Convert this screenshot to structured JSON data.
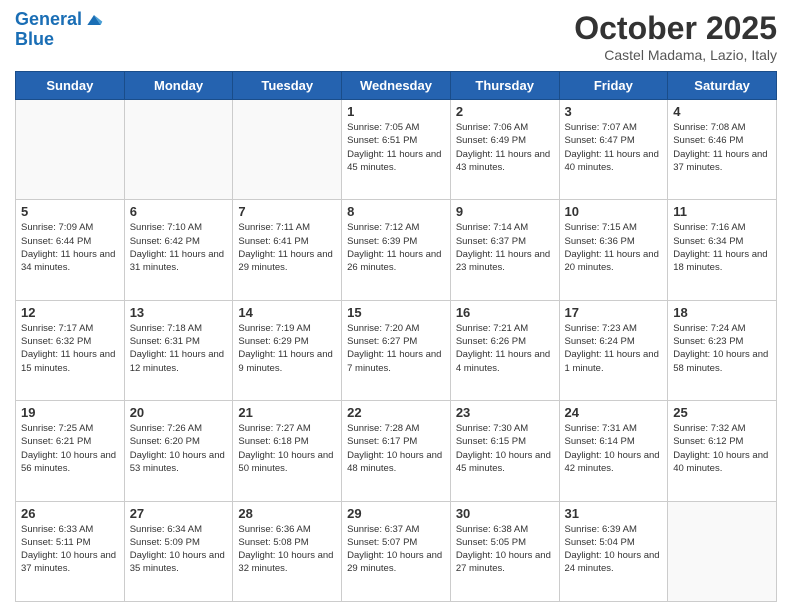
{
  "header": {
    "logo_line1": "General",
    "logo_line2": "Blue",
    "month": "October 2025",
    "location": "Castel Madama, Lazio, Italy"
  },
  "weekdays": [
    "Sunday",
    "Monday",
    "Tuesday",
    "Wednesday",
    "Thursday",
    "Friday",
    "Saturday"
  ],
  "rows": [
    [
      {
        "day": "",
        "info": ""
      },
      {
        "day": "",
        "info": ""
      },
      {
        "day": "",
        "info": ""
      },
      {
        "day": "1",
        "info": "Sunrise: 7:05 AM\nSunset: 6:51 PM\nDaylight: 11 hours and 45 minutes."
      },
      {
        "day": "2",
        "info": "Sunrise: 7:06 AM\nSunset: 6:49 PM\nDaylight: 11 hours and 43 minutes."
      },
      {
        "day": "3",
        "info": "Sunrise: 7:07 AM\nSunset: 6:47 PM\nDaylight: 11 hours and 40 minutes."
      },
      {
        "day": "4",
        "info": "Sunrise: 7:08 AM\nSunset: 6:46 PM\nDaylight: 11 hours and 37 minutes."
      }
    ],
    [
      {
        "day": "5",
        "info": "Sunrise: 7:09 AM\nSunset: 6:44 PM\nDaylight: 11 hours and 34 minutes."
      },
      {
        "day": "6",
        "info": "Sunrise: 7:10 AM\nSunset: 6:42 PM\nDaylight: 11 hours and 31 minutes."
      },
      {
        "day": "7",
        "info": "Sunrise: 7:11 AM\nSunset: 6:41 PM\nDaylight: 11 hours and 29 minutes."
      },
      {
        "day": "8",
        "info": "Sunrise: 7:12 AM\nSunset: 6:39 PM\nDaylight: 11 hours and 26 minutes."
      },
      {
        "day": "9",
        "info": "Sunrise: 7:14 AM\nSunset: 6:37 PM\nDaylight: 11 hours and 23 minutes."
      },
      {
        "day": "10",
        "info": "Sunrise: 7:15 AM\nSunset: 6:36 PM\nDaylight: 11 hours and 20 minutes."
      },
      {
        "day": "11",
        "info": "Sunrise: 7:16 AM\nSunset: 6:34 PM\nDaylight: 11 hours and 18 minutes."
      }
    ],
    [
      {
        "day": "12",
        "info": "Sunrise: 7:17 AM\nSunset: 6:32 PM\nDaylight: 11 hours and 15 minutes."
      },
      {
        "day": "13",
        "info": "Sunrise: 7:18 AM\nSunset: 6:31 PM\nDaylight: 11 hours and 12 minutes."
      },
      {
        "day": "14",
        "info": "Sunrise: 7:19 AM\nSunset: 6:29 PM\nDaylight: 11 hours and 9 minutes."
      },
      {
        "day": "15",
        "info": "Sunrise: 7:20 AM\nSunset: 6:27 PM\nDaylight: 11 hours and 7 minutes."
      },
      {
        "day": "16",
        "info": "Sunrise: 7:21 AM\nSunset: 6:26 PM\nDaylight: 11 hours and 4 minutes."
      },
      {
        "day": "17",
        "info": "Sunrise: 7:23 AM\nSunset: 6:24 PM\nDaylight: 11 hours and 1 minute."
      },
      {
        "day": "18",
        "info": "Sunrise: 7:24 AM\nSunset: 6:23 PM\nDaylight: 10 hours and 58 minutes."
      }
    ],
    [
      {
        "day": "19",
        "info": "Sunrise: 7:25 AM\nSunset: 6:21 PM\nDaylight: 10 hours and 56 minutes."
      },
      {
        "day": "20",
        "info": "Sunrise: 7:26 AM\nSunset: 6:20 PM\nDaylight: 10 hours and 53 minutes."
      },
      {
        "day": "21",
        "info": "Sunrise: 7:27 AM\nSunset: 6:18 PM\nDaylight: 10 hours and 50 minutes."
      },
      {
        "day": "22",
        "info": "Sunrise: 7:28 AM\nSunset: 6:17 PM\nDaylight: 10 hours and 48 minutes."
      },
      {
        "day": "23",
        "info": "Sunrise: 7:30 AM\nSunset: 6:15 PM\nDaylight: 10 hours and 45 minutes."
      },
      {
        "day": "24",
        "info": "Sunrise: 7:31 AM\nSunset: 6:14 PM\nDaylight: 10 hours and 42 minutes."
      },
      {
        "day": "25",
        "info": "Sunrise: 7:32 AM\nSunset: 6:12 PM\nDaylight: 10 hours and 40 minutes."
      }
    ],
    [
      {
        "day": "26",
        "info": "Sunrise: 6:33 AM\nSunset: 5:11 PM\nDaylight: 10 hours and 37 minutes."
      },
      {
        "day": "27",
        "info": "Sunrise: 6:34 AM\nSunset: 5:09 PM\nDaylight: 10 hours and 35 minutes."
      },
      {
        "day": "28",
        "info": "Sunrise: 6:36 AM\nSunset: 5:08 PM\nDaylight: 10 hours and 32 minutes."
      },
      {
        "day": "29",
        "info": "Sunrise: 6:37 AM\nSunset: 5:07 PM\nDaylight: 10 hours and 29 minutes."
      },
      {
        "day": "30",
        "info": "Sunrise: 6:38 AM\nSunset: 5:05 PM\nDaylight: 10 hours and 27 minutes."
      },
      {
        "day": "31",
        "info": "Sunrise: 6:39 AM\nSunset: 5:04 PM\nDaylight: 10 hours and 24 minutes."
      },
      {
        "day": "",
        "info": ""
      }
    ]
  ]
}
